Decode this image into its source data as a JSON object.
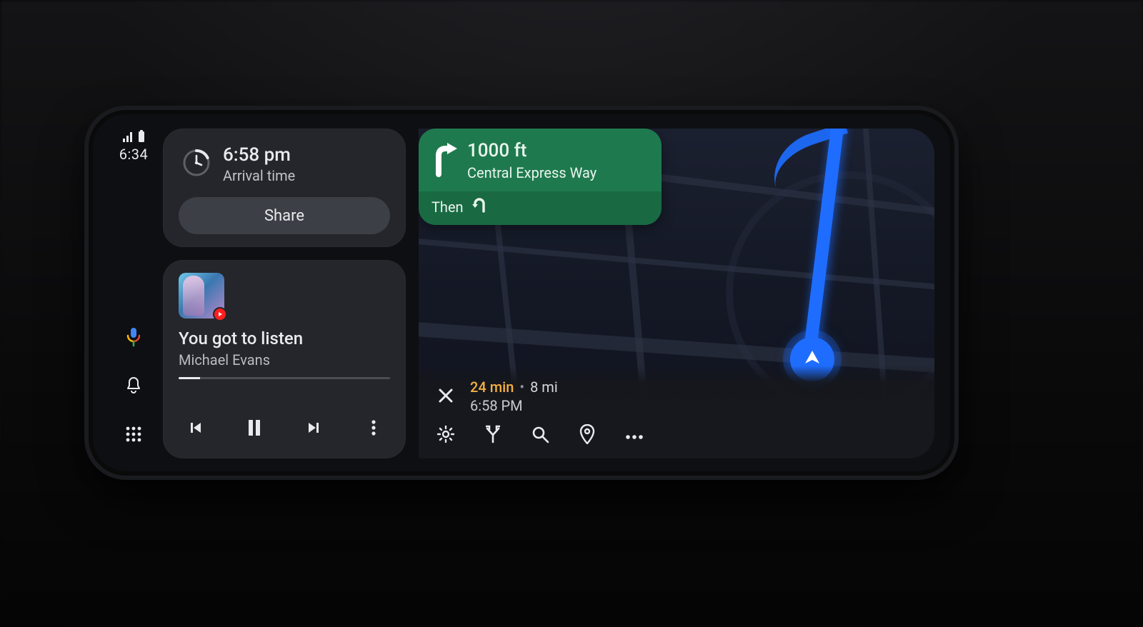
{
  "status": {
    "time": "6:34"
  },
  "eta": {
    "time": "6:58 pm",
    "label": "Arrival time",
    "share_label": "Share"
  },
  "media": {
    "title": "You got to listen",
    "artist": "Michael Evans",
    "progress_pct": 10
  },
  "turn": {
    "distance": "1000 ft",
    "road": "Central Express Way",
    "then_label": "Then"
  },
  "trip": {
    "duration": "24 min",
    "separator": "•",
    "distance": "8 mi",
    "arrival": "6:58 PM"
  }
}
